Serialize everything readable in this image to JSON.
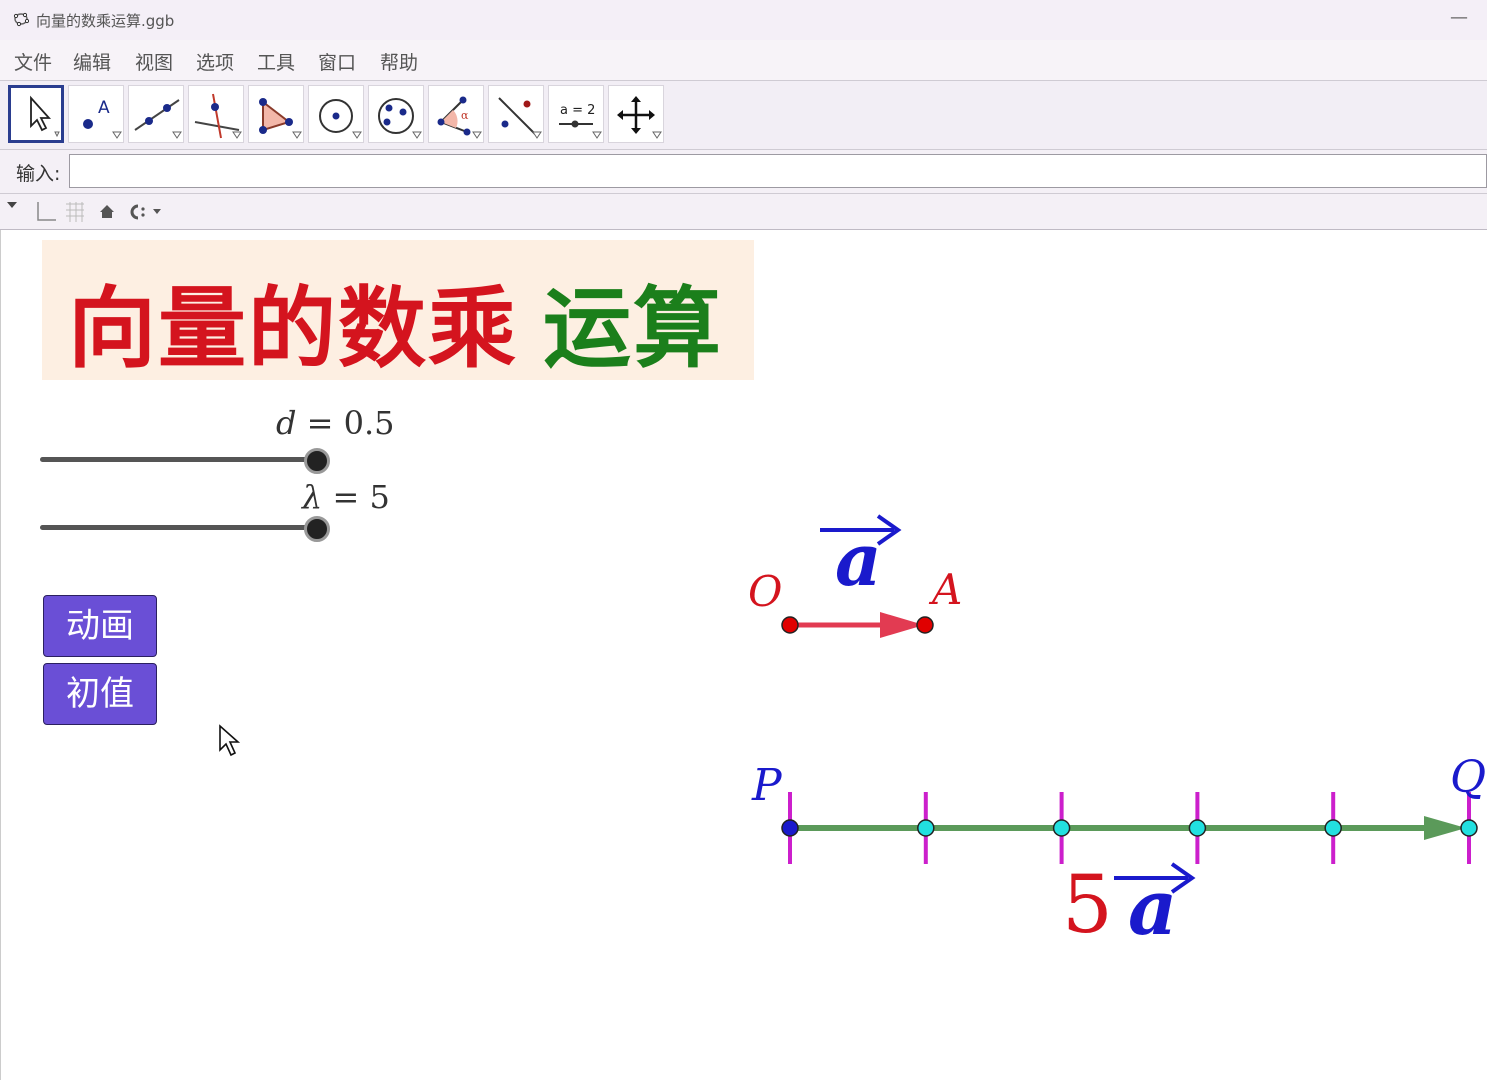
{
  "window": {
    "title": "向量的数乘运算.ggb",
    "minimize_label": "—"
  },
  "menu": [
    {
      "label": "文件"
    },
    {
      "label": "编辑"
    },
    {
      "label": "视图"
    },
    {
      "label": "选项"
    },
    {
      "label": "工具"
    },
    {
      "label": "窗口"
    },
    {
      "label": "帮助"
    }
  ],
  "toolbar": {
    "tools": [
      {
        "icon": "move-pointer-icon",
        "active": true
      },
      {
        "icon": "point-icon"
      },
      {
        "icon": "line-icon"
      },
      {
        "icon": "perpendicular-line-icon"
      },
      {
        "icon": "polygon-icon"
      },
      {
        "icon": "circle-center-point-icon"
      },
      {
        "icon": "conic-ellipse-icon"
      },
      {
        "icon": "angle-icon"
      },
      {
        "icon": "reflect-icon"
      },
      {
        "icon": "slider-icon",
        "text": "a = 2"
      },
      {
        "icon": "move-graphics-view-icon"
      }
    ]
  },
  "input_bar": {
    "label": "输入:",
    "value": ""
  },
  "graphics": {
    "title_red": "向量的数乘",
    "title_green": "运算",
    "sliders": [
      {
        "name": "d",
        "value_text": "0.5",
        "value": 0.5
      },
      {
        "name": "λ",
        "value_text": "5",
        "value": 5
      }
    ],
    "buttons": [
      {
        "label": "动画"
      },
      {
        "label": "初值"
      }
    ],
    "vector_a": {
      "start_label": "O",
      "end_label": "A",
      "name": "a"
    },
    "scaled_vector": {
      "start_label": "P",
      "end_label": "Q",
      "coefficient": "5",
      "name": "a",
      "tick_count": 6
    },
    "colors": {
      "title_red": "#d4141e",
      "title_green": "#1b7f1b",
      "vector_a": "#e23b52",
      "scaled_vector": "#5b9a5a",
      "ticks": "#cc1fcc",
      "point_red": "#e00000",
      "point_cyan": "#22e0e0",
      "point_blue": "#1a1acc",
      "button": "#6a4fd6"
    }
  }
}
